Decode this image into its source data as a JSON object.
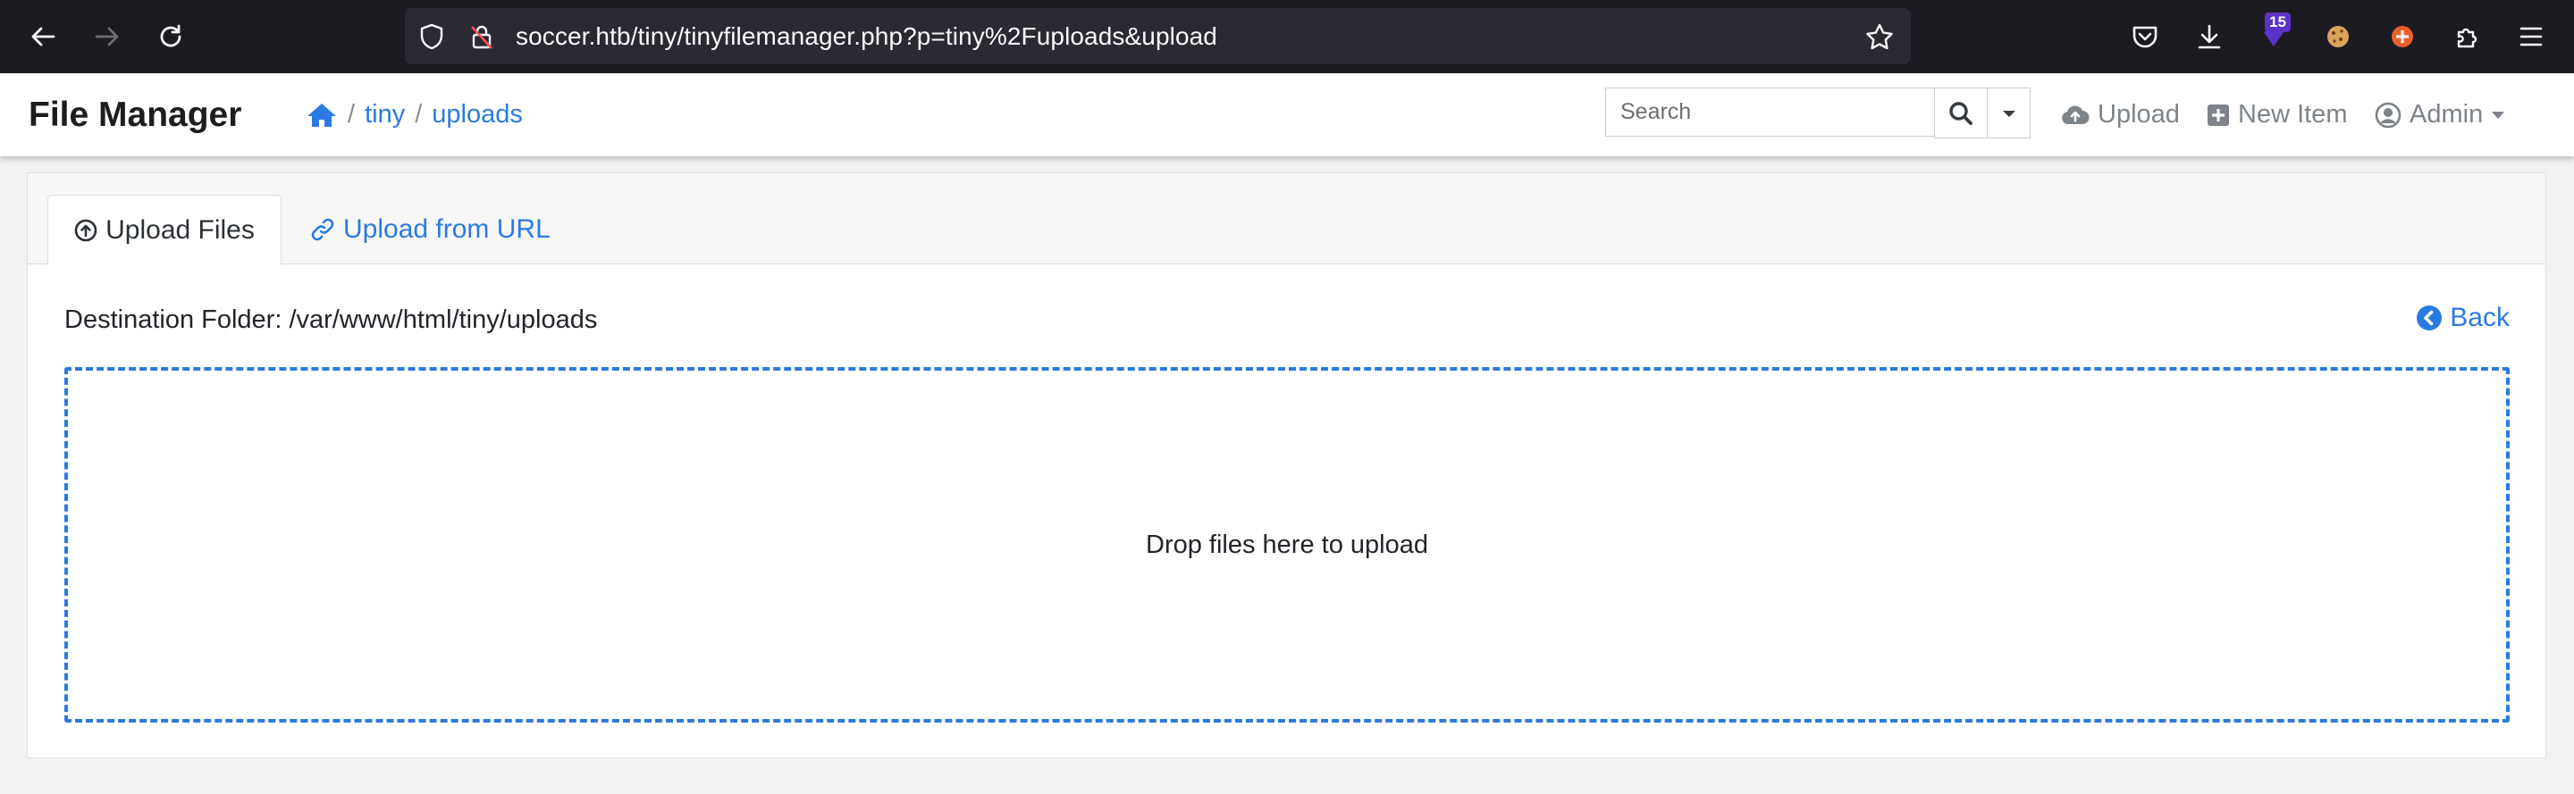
{
  "browser": {
    "url": "soccer.htb/tiny/tinyfilemanager.php?p=tiny%2Fuploads&upload",
    "extension_badge": "15"
  },
  "navbar": {
    "brand": "File Manager",
    "breadcrumb": {
      "separator": "/",
      "items": [
        "tiny",
        "uploads"
      ]
    },
    "search": {
      "placeholder": "Search"
    },
    "actions": {
      "upload": "Upload",
      "new_item": "New Item",
      "user": "Admin"
    }
  },
  "upload_panel": {
    "tabs": {
      "upload_files": "Upload Files",
      "upload_from_url": "Upload from URL"
    },
    "destination_label": "Destination Folder: /var/www/html/tiny/uploads",
    "back_label": "Back",
    "dropzone_text": "Drop files here to upload"
  },
  "colors": {
    "accent": "#2a7ae2",
    "chrome_bg": "#1c1b22",
    "muted": "#7d8389"
  }
}
